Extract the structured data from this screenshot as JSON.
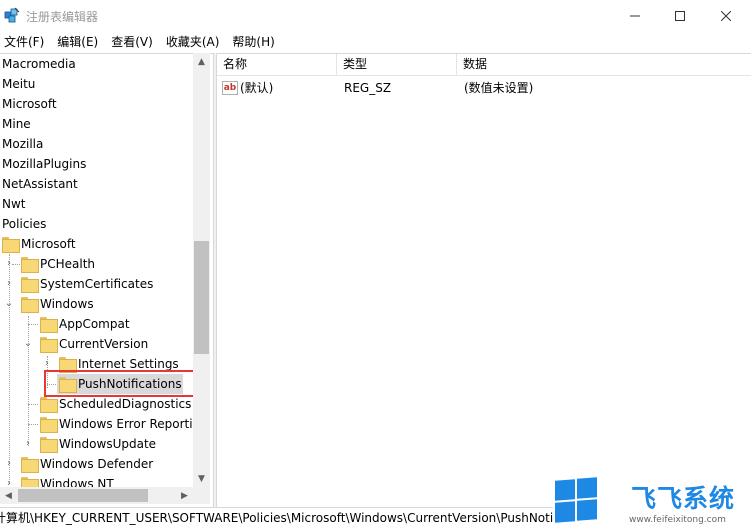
{
  "window": {
    "title": "注册表编辑器",
    "minimize_glyph": "—",
    "maximize_glyph": "☐",
    "close_glyph": "✕"
  },
  "menu": [
    "文件(F)",
    "编辑(E)",
    "查看(V)",
    "收藏夹(A)",
    "帮助(H)"
  ],
  "tree": {
    "top_items": [
      "Macromedia",
      "Meitu",
      "Microsoft",
      "Mine",
      "Mozilla",
      "MozillaPlugins",
      "NetAssistant",
      "Nwt",
      "Policies"
    ],
    "policies_microsoft": "Microsoft",
    "ms_children": [
      "PCHealth",
      "SystemCertificates",
      "Windows"
    ],
    "windows_children": [
      "AppCompat",
      "CurrentVersion"
    ],
    "cv_children": [
      "Internet Settings",
      "PushNotifications"
    ],
    "windows_more": [
      "ScheduledDiagnostics",
      "Windows Error Reporti",
      "WindowsUpdate"
    ],
    "ms_more": [
      "Windows Defender",
      "Windows NT"
    ],
    "selected": "PushNotifications"
  },
  "list": {
    "columns": [
      "名称",
      "类型",
      "数据"
    ],
    "rows": [
      {
        "name": "(默认)",
        "type": "REG_SZ",
        "data": "(数值未设置)",
        "icon": "string-value-icon"
      }
    ]
  },
  "status": {
    "path": "计算机\\HKEY_CURRENT_USER\\SOFTWARE\\Policies\\Microsoft\\Windows\\CurrentVersion\\PushNotifications"
  },
  "watermark": {
    "title": "飞飞系统",
    "url": "www.feifeixitong.com"
  },
  "colors": {
    "highlight_border": "#e53935",
    "folder": "#f8d775",
    "watermark_blue": "#1e88e5"
  }
}
